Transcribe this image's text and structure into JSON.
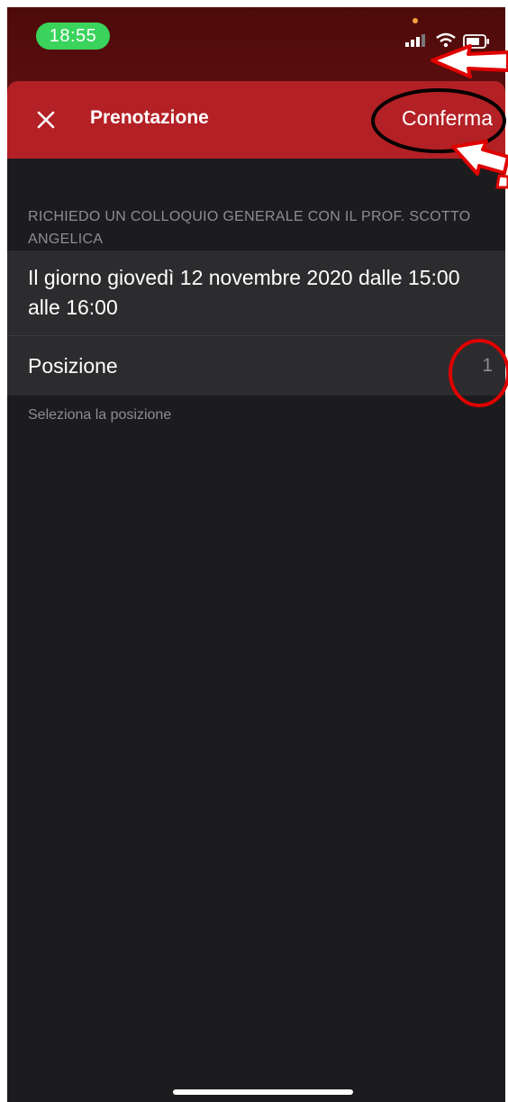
{
  "status_bar": {
    "time": "18:55",
    "icons": [
      "signal-icon",
      "wifi-icon",
      "battery-icon"
    ],
    "time_pill_color": "#3ad35b"
  },
  "nav": {
    "close_icon": "close-icon",
    "title": "Prenotazione",
    "confirm_label": "Conferma",
    "background_color": "#b32025"
  },
  "section": {
    "header": "RICHIEDO UN COLLOQUIO GENERALE CON IL PROF. SCOTTO ANGELICA"
  },
  "rows": {
    "date_text": "Il giorno giovedì 12 novembre 2020 dalle 15:00 alle 16:00",
    "position_label": "Posizione",
    "position_value": "1"
  },
  "footer_note": "Seleziona la posizione",
  "annotations": {
    "arrow_color": "#ff0000",
    "circle_colors": [
      "#000000",
      "#e00000"
    ]
  }
}
